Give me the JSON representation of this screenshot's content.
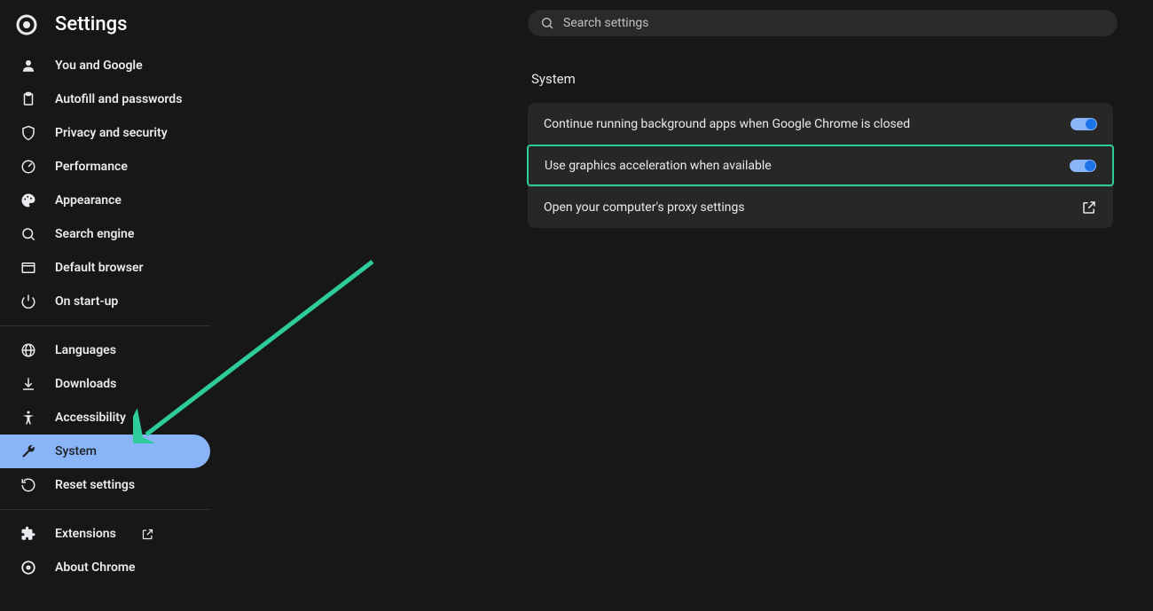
{
  "header": {
    "title": "Settings"
  },
  "search": {
    "placeholder": "Search settings"
  },
  "sidebar": {
    "groups": [
      [
        {
          "id": "you-google",
          "label": "You and Google"
        },
        {
          "id": "autofill",
          "label": "Autofill and passwords"
        },
        {
          "id": "privacy",
          "label": "Privacy and security"
        },
        {
          "id": "performance",
          "label": "Performance"
        },
        {
          "id": "appearance",
          "label": "Appearance"
        },
        {
          "id": "search-engine",
          "label": "Search engine"
        },
        {
          "id": "default-browser",
          "label": "Default browser"
        },
        {
          "id": "startup",
          "label": "On start-up"
        }
      ],
      [
        {
          "id": "languages",
          "label": "Languages"
        },
        {
          "id": "downloads",
          "label": "Downloads"
        },
        {
          "id": "accessibility",
          "label": "Accessibility"
        },
        {
          "id": "system",
          "label": "System",
          "selected": true
        },
        {
          "id": "reset",
          "label": "Reset settings"
        }
      ],
      [
        {
          "id": "extensions",
          "label": "Extensions",
          "extlink": true
        },
        {
          "id": "about",
          "label": "About Chrome"
        }
      ]
    ]
  },
  "main": {
    "section_title": "System",
    "rows": [
      {
        "id": "bg-apps",
        "label": "Continue running background apps when Google Chrome is closed",
        "toggle": true
      },
      {
        "id": "gpu",
        "label": "Use graphics acceleration when available",
        "toggle": true,
        "highlight": true
      },
      {
        "id": "proxy",
        "label": "Open your computer's proxy settings",
        "external": true
      }
    ]
  }
}
